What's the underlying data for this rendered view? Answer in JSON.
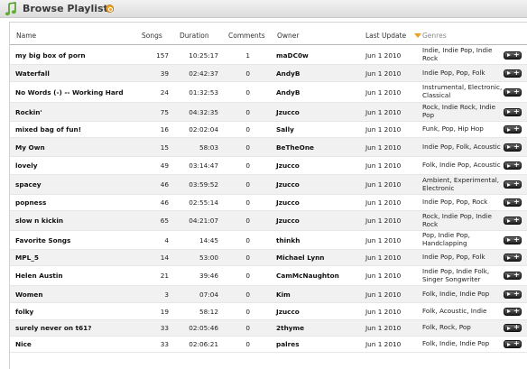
{
  "header": {
    "title": "Browse Playlists",
    "title_icon": "music-note-icon",
    "feed_icon": "rss-icon"
  },
  "table": {
    "columns": {
      "name": "Name",
      "songs": "Songs",
      "duration": "Duration",
      "comments": "Comments",
      "owner": "Owner",
      "last_update": "Last Update",
      "genres": "Genres"
    },
    "sort_column": "last_update",
    "sort_icon": "sort-desc-icon",
    "row_action_icon": "play-add-icon",
    "rows": [
      {
        "name": "my big box of porn",
        "songs": "157",
        "duration": "10:25:17",
        "comments": "1",
        "owner": "maDC0w",
        "updated": "Jun 1 2010",
        "genres": "Indie, Indie Pop, Indie Rock"
      },
      {
        "name": "Waterfall",
        "songs": "39",
        "duration": "02:42:37",
        "comments": "0",
        "owner": "AndyB",
        "updated": "Jun 1 2010",
        "genres": "Indie Pop, Pop, Folk"
      },
      {
        "name": "No Words (-) -- Working Hard",
        "songs": "24",
        "duration": "01:32:53",
        "comments": "0",
        "owner": "AndyB",
        "updated": "Jun 1 2010",
        "genres": "Instrumental, Electronic, Classical"
      },
      {
        "name": "Rockin'",
        "songs": "75",
        "duration": "04:32:35",
        "comments": "0",
        "owner": "Jzucco",
        "updated": "Jun 1 2010",
        "genres": "Rock, Indie Rock, Indie Pop"
      },
      {
        "name": "mixed bag of fun!",
        "songs": "16",
        "duration": "02:02:04",
        "comments": "0",
        "owner": "Sally",
        "updated": "Jun 1 2010",
        "genres": "Funk, Pop, Hip Hop"
      },
      {
        "name": "My Own",
        "songs": "15",
        "duration": "58:03",
        "comments": "0",
        "owner": "BeTheOne",
        "updated": "Jun 1 2010",
        "genres": "Indie Pop, Folk, Acoustic"
      },
      {
        "name": "lovely",
        "songs": "49",
        "duration": "03:14:47",
        "comments": "0",
        "owner": "Jzucco",
        "updated": "Jun 1 2010",
        "genres": "Folk, Indie Pop, Acoustic"
      },
      {
        "name": "spacey",
        "songs": "46",
        "duration": "03:59:52",
        "comments": "0",
        "owner": "Jzucco",
        "updated": "Jun 1 2010",
        "genres": "Ambient, Experimental, Electronic"
      },
      {
        "name": "popness",
        "songs": "46",
        "duration": "02:55:14",
        "comments": "0",
        "owner": "Jzucco",
        "updated": "Jun 1 2010",
        "genres": "Indie Pop, Pop, Rock"
      },
      {
        "name": "slow n kickin",
        "songs": "65",
        "duration": "04:21:07",
        "comments": "0",
        "owner": "Jzucco",
        "updated": "Jun 1 2010",
        "genres": "Rock, Indie Pop, Indie Rock"
      },
      {
        "name": "Favorite Songs",
        "songs": "4",
        "duration": "14:45",
        "comments": "0",
        "owner": "thinkh",
        "updated": "Jun 1 2010",
        "genres": "Pop, Indie Pop, Handclapping"
      },
      {
        "name": "MPL_5",
        "songs": "14",
        "duration": "53:00",
        "comments": "0",
        "owner": "Michael Lynn",
        "updated": "Jun 1 2010",
        "genres": "Indie Pop, Pop, Folk"
      },
      {
        "name": "Helen Austin",
        "songs": "21",
        "duration": "39:46",
        "comments": "0",
        "owner": "CamMcNaughton",
        "updated": "Jun 1 2010",
        "genres": "Indie Pop, Indie Folk, Singer Songwriter"
      },
      {
        "name": "Women",
        "songs": "3",
        "duration": "07:04",
        "comments": "0",
        "owner": "Kim",
        "updated": "Jun 1 2010",
        "genres": "Folk, Indie, Indie Pop"
      },
      {
        "name": "folky",
        "songs": "19",
        "duration": "58:12",
        "comments": "0",
        "owner": "Jzucco",
        "updated": "Jun 1 2010",
        "genres": "Folk, Acoustic, Indie"
      },
      {
        "name": "surely never on t61?",
        "songs": "33",
        "duration": "02:05:46",
        "comments": "0",
        "owner": "2thyme",
        "updated": "Jun 1 2010",
        "genres": "Folk, Rock, Pop"
      },
      {
        "name": "Nice",
        "songs": "33",
        "duration": "02:06:21",
        "comments": "0",
        "owner": "palres",
        "updated": "Jun 1 2010",
        "genres": "Folk, Indie, Indie Pop"
      }
    ]
  }
}
